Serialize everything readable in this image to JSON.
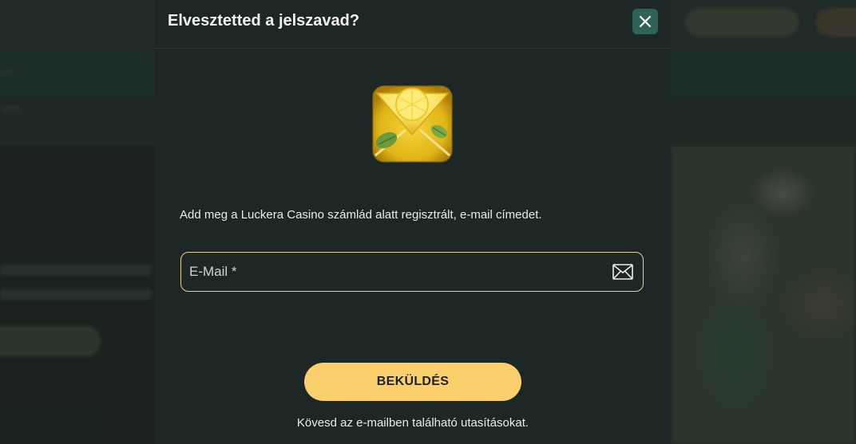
{
  "modal": {
    "title": "Elvesztetted a jelszavad?",
    "close_icon": "close-icon",
    "illustration_icon": "lemon-envelope-icon",
    "instruction": "Add meg a Luckera Casino számlád alatt regisztrált, e-mail címedet.",
    "email_field": {
      "placeholder": "E-Mail *",
      "value": "",
      "icon": "mail-icon"
    },
    "submit_label": "BEKÜLDÉS",
    "followup": "Kövesd az e-mailben található utasításokat."
  },
  "colors": {
    "modal_background": "#1c2726",
    "close_button": "#2f6259",
    "accent_button": "#fbcf6c",
    "input_border": "#e9d08a"
  }
}
